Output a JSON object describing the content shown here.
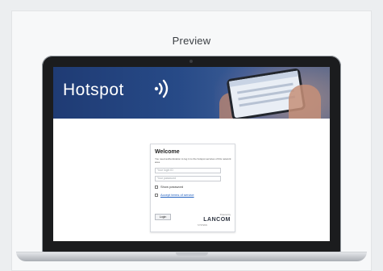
{
  "preview": {
    "title": "Preview"
  },
  "hotspot": {
    "brand": "Hotspot",
    "login": {
      "heading": "Welcome",
      "intro_text": "You need authentication to log in to the hotspot services of this network area.",
      "username_placeholder": "Your login ID",
      "password_placeholder": "Your password",
      "show_password_label": "Show password",
      "accept_terms_label": "Accept terms of service",
      "login_button": "Login",
      "powered_by": "Powered by",
      "vendor_logo": "LANCOM",
      "vendor_sub": "SYSTEMS"
    }
  },
  "icons": {
    "wifi": "wifi-signal-icon"
  },
  "colors": {
    "hero_start": "#1f3b74",
    "hero_end": "#5e6c86",
    "link": "#1f5fbf"
  }
}
